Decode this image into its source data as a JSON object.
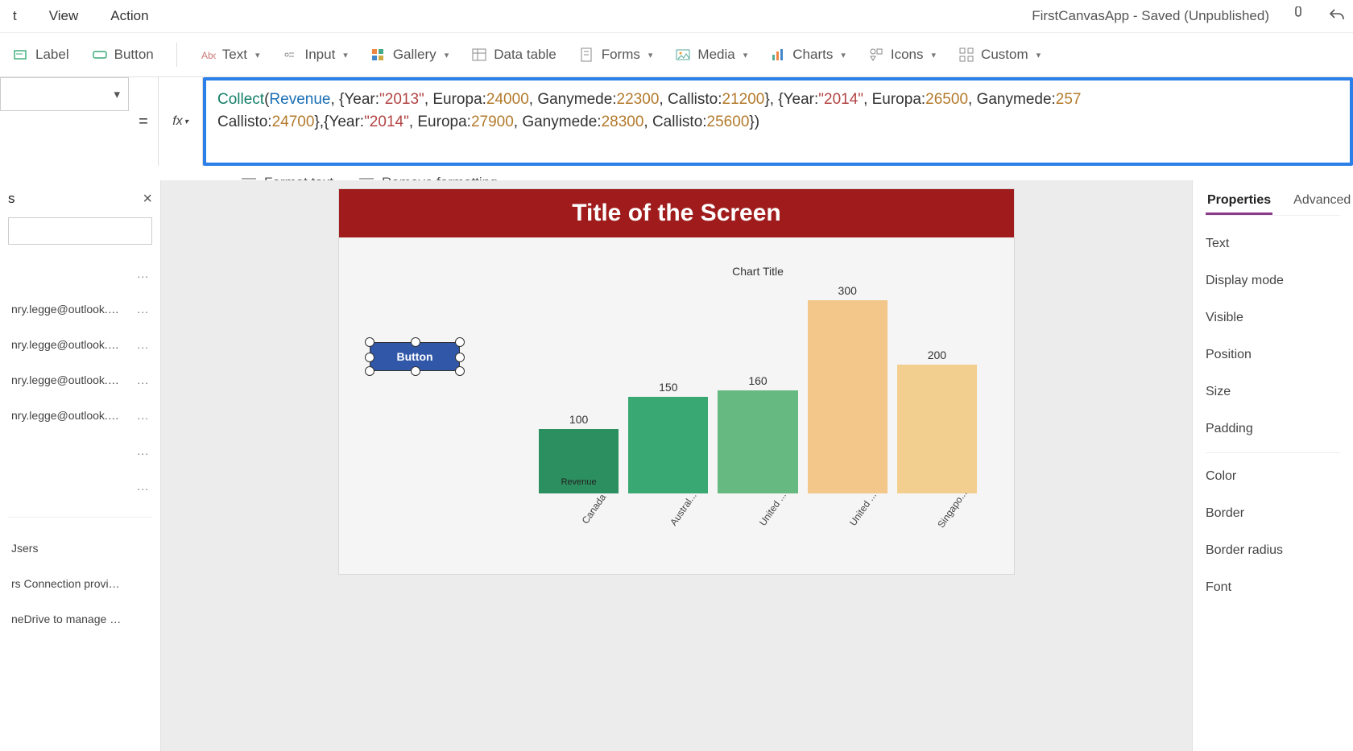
{
  "app_title": "FirstCanvasApp - Saved (Unpublished)",
  "menu": {
    "items": [
      "t",
      "View",
      "Action"
    ]
  },
  "ribbon": {
    "label": "Label",
    "button": "Button",
    "text": "Text",
    "input": "Input",
    "gallery": "Gallery",
    "data_table": "Data table",
    "forms": "Forms",
    "media": "Media",
    "charts": "Charts",
    "icons": "Icons",
    "custom": "Custom"
  },
  "formula_row": {
    "eq": "=",
    "fx": "fx",
    "tokens": [
      {
        "t": "fn",
        "v": "Collect"
      },
      {
        "t": "plain",
        "v": "("
      },
      {
        "t": "id",
        "v": "Revenue"
      },
      {
        "t": "plain",
        "v": ", {Year:"
      },
      {
        "t": "str",
        "v": "\"2013\""
      },
      {
        "t": "plain",
        "v": ", Europa:"
      },
      {
        "t": "num",
        "v": "24000"
      },
      {
        "t": "plain",
        "v": ", Ganymede:"
      },
      {
        "t": "num",
        "v": "22300"
      },
      {
        "t": "plain",
        "v": ", Callisto:"
      },
      {
        "t": "num",
        "v": "21200"
      },
      {
        "t": "plain",
        "v": "}, {Year:"
      },
      {
        "t": "str",
        "v": "\"2014\""
      },
      {
        "t": "plain",
        "v": ", Europa:"
      },
      {
        "t": "num",
        "v": "26500"
      },
      {
        "t": "plain",
        "v": ", Ganymede:"
      },
      {
        "t": "num",
        "v": "257"
      },
      {
        "t": "plain",
        "v": "\nCallisto:"
      },
      {
        "t": "num",
        "v": "24700"
      },
      {
        "t": "plain",
        "v": "},{Year:"
      },
      {
        "t": "str",
        "v": "\"2014\""
      },
      {
        "t": "plain",
        "v": ", Europa:"
      },
      {
        "t": "num",
        "v": "27900"
      },
      {
        "t": "plain",
        "v": ", Ganymede:"
      },
      {
        "t": "num",
        "v": "28300"
      },
      {
        "t": "plain",
        "v": ", Callisto:"
      },
      {
        "t": "num",
        "v": "25600"
      },
      {
        "t": "plain",
        "v": "})"
      }
    ]
  },
  "fmt_row": {
    "format_text": "Format text",
    "remove_fmt": "Remove formatting"
  },
  "leftpanel": {
    "title": "s",
    "items": [
      {
        "text": "",
        "dots": "..."
      },
      {
        "text": "nry.legge@outlook.com",
        "dots": "..."
      },
      {
        "text": "nry.legge@outlook.com",
        "dots": "..."
      },
      {
        "text": "nry.legge@outlook.com",
        "dots": "..."
      },
      {
        "text": "nry.legge@outlook.com",
        "dots": "..."
      },
      {
        "text": "",
        "dots": "..."
      },
      {
        "text": "",
        "dots": "..."
      }
    ],
    "footer": [
      "Jsers",
      "rs Connection provider lets you ...",
      "neDrive to manage your files. Yo..."
    ]
  },
  "canvas": {
    "screen_title": "Title of the Screen",
    "button_label": "Button"
  },
  "chart_data": {
    "type": "bar",
    "title": "Chart Title",
    "categories": [
      "Canada",
      "Austral...",
      "United ...",
      "United ...",
      "Singapo..."
    ],
    "values": [
      100,
      150,
      160,
      300,
      200
    ],
    "colors": [
      "#2c8f5f",
      "#3aa873",
      "#66b981",
      "#f3c68a",
      "#f3cf8f"
    ],
    "ylim": [
      0,
      300
    ],
    "legend_inbar": "Revenue"
  },
  "rpanel": {
    "tabs": [
      "Properties",
      "Advanced"
    ],
    "props": [
      "Text",
      "Display mode",
      "Visible",
      "Position",
      "Size",
      "Padding"
    ],
    "props2": [
      "Color",
      "Border",
      "Border radius",
      "Font"
    ]
  }
}
